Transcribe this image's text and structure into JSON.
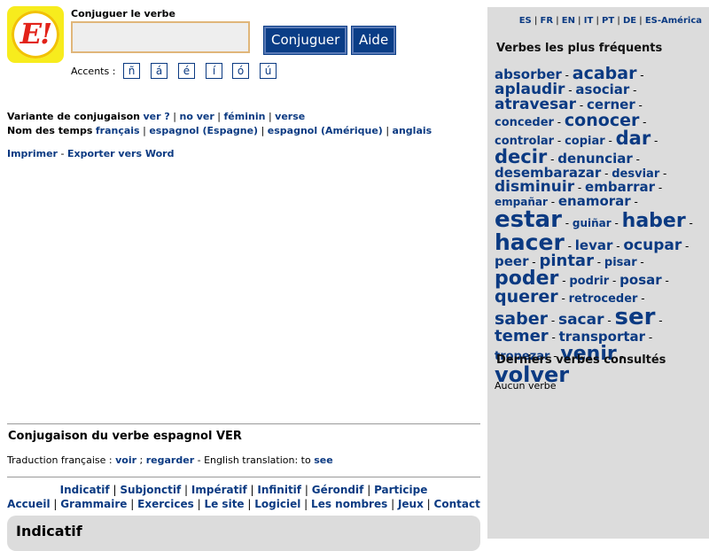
{
  "search": {
    "title": "Conjuguer le verbe",
    "input_value": "",
    "conjugate_label": "Conjuguer",
    "help_label": "Aide",
    "accents_label": "Accents :",
    "accents": [
      "ñ",
      "á",
      "é",
      "í",
      "ó",
      "ú"
    ]
  },
  "logo_text": "E!",
  "variant": {
    "label": "Variante de conjugaison",
    "links": [
      "ver ?",
      "no ver",
      "féminin",
      "verse"
    ]
  },
  "tenses": {
    "label": "Nom des temps",
    "links": [
      "français",
      "espagnol (Espagne)",
      "espagnol (Amérique)",
      "anglais"
    ]
  },
  "actions": {
    "print": "Imprimer",
    "dash": "-",
    "export": "Exporter vers Word"
  },
  "conjugation": {
    "heading": "Conjugaison du verbe espagnol VER",
    "trad_label": "Traduction française :",
    "trad_links": [
      "voir",
      "regarder"
    ],
    "trad_sep": ";",
    "english_label": "- English translation: to",
    "english_link": "see"
  },
  "nav1": [
    "Indicatif",
    "Subjonctif",
    "Impératif",
    "Infinitif",
    "Gérondif",
    "Participe"
  ],
  "nav2": [
    "Accueil",
    "Grammaire",
    "Exercices",
    "Le site",
    "Logiciel",
    "Les nombres",
    "Jeux",
    "Contact"
  ],
  "section_title": "Indicatif",
  "sidebar": {
    "languages": [
      "ES",
      "FR",
      "EN",
      "IT",
      "PT",
      "DE",
      "ES-América"
    ],
    "frequent_title": "Verbes les plus fréquents",
    "recent_title": "Derniers verbes consultés",
    "recent_none": "Aucun verbe",
    "cloud": [
      {
        "w": "absorber",
        "s": 15
      },
      {
        "w": "acabar",
        "s": 19
      },
      {
        "w": "aplaudir",
        "s": 17
      },
      {
        "w": "asociar",
        "s": 15
      },
      {
        "w": "atravesar",
        "s": 17
      },
      {
        "w": "cerner",
        "s": 15
      },
      {
        "w": "conceder",
        "s": 13
      },
      {
        "w": "conocer",
        "s": 19
      },
      {
        "w": "controlar",
        "s": 13
      },
      {
        "w": "copiar",
        "s": 13
      },
      {
        "w": "dar",
        "s": 21
      },
      {
        "w": "decir",
        "s": 21
      },
      {
        "w": "denunciar",
        "s": 15
      },
      {
        "w": "desembarazar",
        "s": 15
      },
      {
        "w": "desviar",
        "s": 13
      },
      {
        "w": "disminuir",
        "s": 17
      },
      {
        "w": "embarrar",
        "s": 15
      },
      {
        "w": "empañar",
        "s": 12
      },
      {
        "w": "enamorar",
        "s": 15
      },
      {
        "w": "estar",
        "s": 26
      },
      {
        "w": "guiñar",
        "s": 12
      },
      {
        "w": "haber",
        "s": 22
      },
      {
        "w": "hacer",
        "s": 25
      },
      {
        "w": "levar",
        "s": 15
      },
      {
        "w": "ocupar",
        "s": 17
      },
      {
        "w": "peer",
        "s": 15
      },
      {
        "w": "pintar",
        "s": 18
      },
      {
        "w": "pisar",
        "s": 13
      },
      {
        "w": "poder",
        "s": 22
      },
      {
        "w": "podrir",
        "s": 13
      },
      {
        "w": "posar",
        "s": 15
      },
      {
        "w": "querer",
        "s": 19
      },
      {
        "w": "retroceder",
        "s": 13
      },
      {
        "w": "saber",
        "s": 19
      },
      {
        "w": "sacar",
        "s": 17
      },
      {
        "w": "ser",
        "s": 26
      },
      {
        "w": "temer",
        "s": 18
      },
      {
        "w": "transportar",
        "s": 15
      },
      {
        "w": "tropezar",
        "s": 13
      },
      {
        "w": "venir",
        "s": 22
      },
      {
        "w": "volver",
        "s": 24
      }
    ]
  },
  "colors": {
    "link": "#0b3a82",
    "button": "#0a3d86",
    "sidebar": "#dcdcdc",
    "logo": "#f7ec1d"
  }
}
